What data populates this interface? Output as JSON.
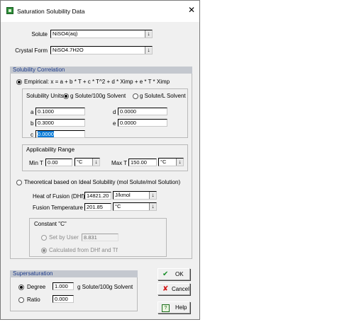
{
  "window": {
    "title": "Saturation Solubility Data",
    "close_glyph": "✕"
  },
  "solute": {
    "label": "Solute",
    "value": "NiSO4(aq)"
  },
  "crystal_form": {
    "label": "Crystal Form",
    "value": "NiSO4.7H2O"
  },
  "correlation": {
    "header": "Solubility Correlation",
    "empirical_label": "Empirical:  x = a + b * T + c * T^2 + d * Ximp + e * T * Ximp",
    "units_label": "Solubility Units",
    "unit_option1": "g Solute/100g Solvent",
    "unit_option2": "g Solute/L Solvent",
    "coefficients": {
      "a_label": "a",
      "a": "0.1000",
      "b_label": "b",
      "b": "0.3000",
      "c_label": "c",
      "c": "0.0000",
      "d_label": "d",
      "d": "0.0000",
      "e_label": "e",
      "e": "0.0000"
    },
    "range": {
      "title": "Applicability Range",
      "min_label": "Min T",
      "min_value": "0.00",
      "min_unit": "°C",
      "max_label": "Max T",
      "max_value": "150.00",
      "max_unit": "°C"
    },
    "theoretical_label": "Theoretical based on Ideal Solubility (mol Solute/mol Solution)",
    "heat_label": "Heat of Fusion (DHf)",
    "heat_value": "14821.20",
    "heat_unit": "J/kmol",
    "fusion_label": "Fusion Temperature",
    "fusion_value": "201.85",
    "fusion_unit": "°C",
    "constant": {
      "title": "Constant \"C\"",
      "option1": "Set by User",
      "option1_value": "8.831",
      "option2": "Calculated from DHf and Tf"
    }
  },
  "supersaturation": {
    "header": "Supersaturation",
    "degree_label": "Degree",
    "degree_value": "1.000",
    "degree_unit": "g Solute/100g Solvent",
    "ratio_label": "Ratio",
    "ratio_value": "0.000"
  },
  "buttons": {
    "ok": "OK",
    "ok_icon": "✔",
    "cancel": "Cancel",
    "cancel_icon": "✘",
    "help": "Help",
    "help_icon": "?"
  },
  "colors": {
    "section_header_bg": "#c4c8cf",
    "section_header_text": "#1b3a8a",
    "selection": "#0078d7"
  }
}
